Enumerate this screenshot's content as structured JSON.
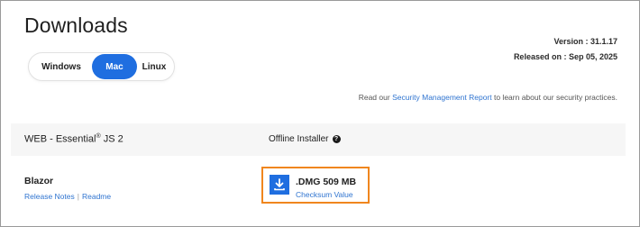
{
  "page": {
    "title": "Downloads"
  },
  "os_toggle": {
    "options": [
      "Windows",
      "Mac",
      "Linux"
    ],
    "selected": "Mac"
  },
  "release": {
    "version": "Version : 31.1.17",
    "released": "Released on : Sep 05, 2025"
  },
  "security_note": {
    "prefix": "Read our ",
    "link": "Security Management Report",
    "suffix": " to learn about our security practices."
  },
  "table": {
    "col1_header_pre": "WEB - Essential",
    "col1_header_sup": "®",
    "col1_header_post": " JS 2",
    "col2_header": "Offline Installer",
    "help_symbol": "?"
  },
  "row": {
    "product": "Blazor",
    "release_notes": "Release Notes",
    "separator": "|",
    "readme": "Readme",
    "download_label": ".DMG 509 MB",
    "checksum": "Checksum Value"
  },
  "colors": {
    "accent": "#1f6ee0",
    "link": "#2f74d0",
    "highlight_border": "#f0861e"
  },
  "icons": {
    "download": "download-icon",
    "help": "question-circle-icon"
  }
}
